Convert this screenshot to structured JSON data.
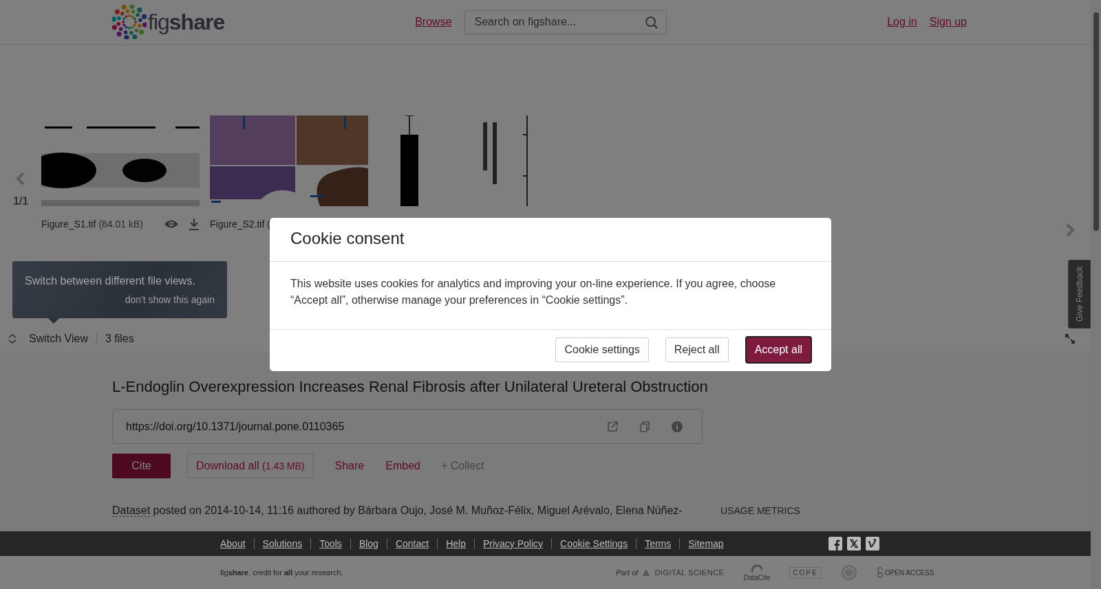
{
  "header": {
    "logo": "fig**share**",
    "nav": [
      {
        "label": "Browse"
      }
    ],
    "search": {
      "placeholder": "Search on figshare..."
    },
    "account": [
      {
        "label": "Log in"
      },
      {
        "label": "Sign up"
      }
    ]
  },
  "viewer": {
    "page": "1/1",
    "files": [
      {
        "kind": "blot",
        "name": "Figure_S1.tif",
        "size": "(84.01 kB)"
      },
      {
        "kind": "tissue",
        "name": "Figure_S2.tif ("
      },
      {
        "kind": "bars"
      }
    ]
  },
  "tooltip": {
    "text": "Switch between different file views.",
    "dismiss": "don't show this again"
  },
  "toolbar": {
    "switch_view": "Switch View",
    "file_count": "3 files"
  },
  "item": {
    "title": "L-Endoglin Overexpression Increases Renal Fibrosis after Unilateral Ureteral Obstruction",
    "doi": "https://doi.org/10.1371/journal.pone.0110365",
    "actions": {
      "cite": "Cite",
      "download": "Download all",
      "download_size": "(1.43 MB)",
      "share": "Share",
      "embed": "Embed",
      "collect": "+ Collect"
    },
    "meta": {
      "type": "Dataset",
      "text": "posted on 2014-10-14, 11:16 authored by Bárbara Oujo, José M. Muñoz-Félix, Miguel Arévalo, Elena Núñez-"
    },
    "usage_heading": "USAGE METRICS"
  },
  "feedback": "Give Feedback",
  "footer": {
    "links": [
      "About",
      "Solutions",
      "Tools",
      "Blog",
      "Contact",
      "Help",
      "Privacy Policy",
      "Cookie Settings",
      "Terms",
      "Sitemap"
    ],
    "tagline": "fig**share**. credit for **all** your research.",
    "partners": {
      "part_of": "Part of",
      "digital_science": "DIGITAL SCIENCE",
      "datacite": "DataCite",
      "cope": "COPE",
      "open_access": "OPEN ACCESS"
    }
  },
  "cookie_dialog": {
    "title": "Cookie consent",
    "body": "This website uses cookies for analytics and improving your on-line experience. If you agree, choose “Accept all”, otherwise manage your preferences in “Cookie settings”.",
    "buttons": [
      {
        "label": "Cookie settings",
        "kind": "secondary"
      },
      {
        "label": "Reject all",
        "kind": "secondary"
      },
      {
        "label": "Accept all",
        "kind": "primary"
      }
    ]
  }
}
